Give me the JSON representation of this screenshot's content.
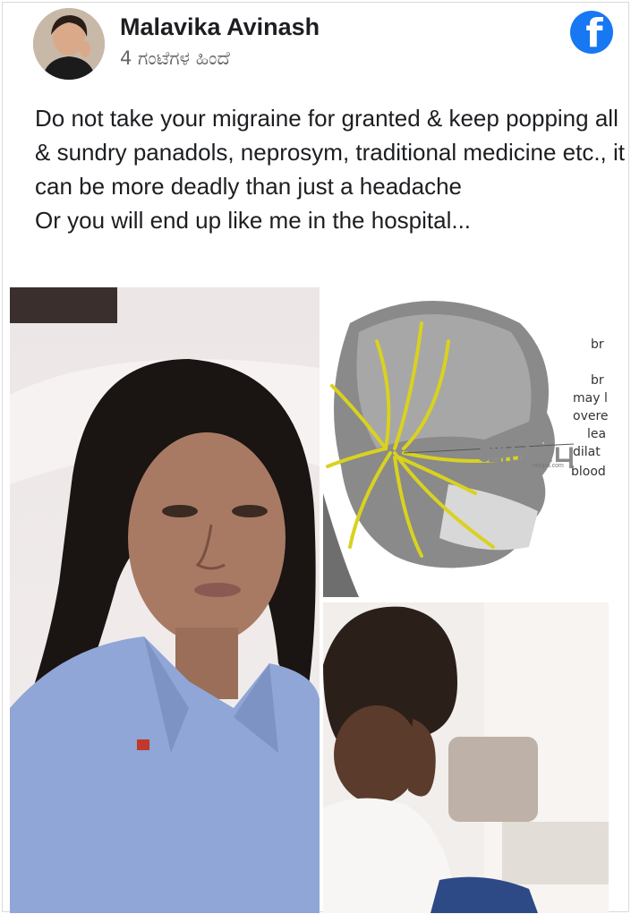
{
  "post": {
    "author": "Malavika Avinash",
    "timestamp": "4 ಗಂಟೆಗಳ ಹಿಂದೆ",
    "platform_icon": "facebook-icon",
    "text_lines": [
      "Do not take your migraine for granted & keep popping all & sundry panadols, neprosym, traditional medicine etc., it can be more deadly than just a headache",
      "Or you will end up like me in the hospital..."
    ]
  },
  "images": {
    "diagram_captions": [
      "br",
      "br",
      "may l",
      "overe",
      "lea",
      "dilat",
      "blood"
    ],
    "watermark": "விடுப்பு",
    "watermark_sub": "vidupu.com"
  },
  "colors": {
    "facebook_blue": "#1877f2",
    "nerve_yellow": "#d9d21f"
  }
}
